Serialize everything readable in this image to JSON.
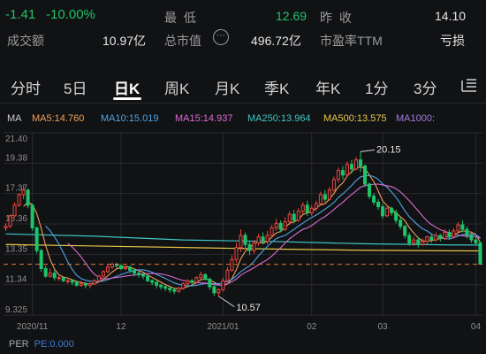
{
  "stats": {
    "change": "-1.41",
    "change_pct": "-10.00%",
    "low_label": "最 低",
    "low_value": "12.69",
    "prev_close_label": "昨 收",
    "prev_close_value": "14.10",
    "turnover_label": "成交额",
    "turnover_value": "10.97亿",
    "mktcap_label": "总市值",
    "mktcap_value": "496.72亿",
    "pe_label": "市盈率TTM",
    "pe_value": "亏损"
  },
  "tabs": [
    "分时",
    "5日",
    "日K",
    "周K",
    "月K",
    "季K",
    "年K",
    "1分",
    "3分"
  ],
  "active_tab": "日K",
  "ma": {
    "title": "MA",
    "items": [
      {
        "text": "MA5:14.760",
        "color": "#f0a05a"
      },
      {
        "text": "MA10:15.019",
        "color": "#4fa3e6"
      },
      {
        "text": "MA15:14.937",
        "color": "#d86cd3"
      },
      {
        "text": "MA250:13.964",
        "color": "#3fc5c5"
      },
      {
        "text": "MA500:13.575",
        "color": "#e6c64a"
      },
      {
        "text": "MA1000:",
        "color": "#a27be0"
      }
    ]
  },
  "chart_data": {
    "type": "candlestick",
    "y_ticks": [
      "21.40",
      "19.38",
      "17.37",
      "15.36",
      "13.35",
      "11.34",
      "9.325"
    ],
    "ylim": [
      9.325,
      21.4
    ],
    "x_labels": [
      {
        "label": "2020/11",
        "index": 6
      },
      {
        "label": "12",
        "index": 26
      },
      {
        "label": "2021/01",
        "index": 49
      },
      {
        "label": "02",
        "index": 69
      },
      {
        "label": "03",
        "index": 85
      },
      {
        "label": "04",
        "index": 106
      }
    ],
    "annotations": [
      {
        "label": "20.15",
        "index": 80,
        "value": 20.15
      },
      {
        "label": "10.57",
        "index": 48,
        "value": 10.57
      }
    ],
    "current_price": 12.69,
    "candles": [
      [
        15.1,
        15.2,
        14.9,
        15.4
      ],
      [
        15.2,
        15.9,
        15.1,
        16.0
      ],
      [
        15.9,
        16.6,
        15.8,
        16.8
      ],
      [
        16.6,
        17.3,
        16.5,
        17.4
      ],
      [
        17.3,
        17.6,
        17.0,
        17.9
      ],
      [
        17.6,
        16.6,
        16.4,
        17.7
      ],
      [
        16.6,
        15.1,
        14.9,
        16.7
      ],
      [
        15.1,
        13.6,
        13.4,
        15.2
      ],
      [
        13.6,
        12.4,
        12.2,
        13.7
      ],
      [
        12.4,
        11.9,
        11.8,
        12.6
      ],
      [
        11.9,
        12.1,
        11.8,
        12.4
      ],
      [
        12.1,
        11.8,
        11.6,
        12.3
      ],
      [
        11.8,
        11.8,
        11.6,
        12.0
      ],
      [
        11.8,
        11.6,
        11.5,
        11.9
      ],
      [
        11.6,
        11.6,
        11.4,
        11.8
      ],
      [
        11.6,
        11.5,
        11.3,
        11.7
      ],
      [
        11.5,
        11.3,
        11.2,
        11.6
      ],
      [
        11.3,
        11.4,
        11.2,
        11.6
      ],
      [
        11.4,
        11.3,
        11.1,
        11.5
      ],
      [
        11.3,
        11.4,
        11.1,
        11.5
      ],
      [
        11.4,
        11.6,
        11.3,
        11.7
      ],
      [
        11.6,
        11.9,
        11.5,
        12.0
      ],
      [
        11.9,
        12.2,
        11.8,
        12.3
      ],
      [
        12.2,
        12.5,
        12.1,
        12.7
      ],
      [
        12.5,
        12.7,
        12.4,
        12.8
      ],
      [
        12.7,
        12.6,
        12.4,
        12.8
      ],
      [
        12.6,
        12.4,
        12.3,
        12.7
      ],
      [
        12.4,
        12.5,
        12.3,
        12.6
      ],
      [
        12.5,
        12.3,
        12.1,
        12.6
      ],
      [
        12.3,
        12.1,
        11.9,
        12.4
      ],
      [
        12.1,
        12.0,
        11.8,
        12.2
      ],
      [
        12.0,
        11.9,
        11.7,
        12.1
      ],
      [
        11.9,
        11.6,
        11.5,
        12.0
      ],
      [
        11.6,
        11.5,
        11.3,
        11.7
      ],
      [
        11.5,
        11.3,
        11.1,
        11.6
      ],
      [
        11.3,
        11.2,
        11.0,
        11.4
      ],
      [
        11.2,
        11.1,
        10.9,
        11.3
      ],
      [
        11.1,
        11.0,
        10.8,
        11.2
      ],
      [
        11.0,
        10.9,
        10.7,
        11.1
      ],
      [
        10.9,
        11.1,
        10.8,
        11.2
      ],
      [
        11.1,
        11.4,
        11.0,
        11.5
      ],
      [
        11.4,
        11.6,
        11.3,
        11.7
      ],
      [
        11.6,
        11.5,
        11.3,
        11.7
      ],
      [
        11.5,
        11.8,
        11.4,
        11.9
      ],
      [
        11.8,
        12.0,
        11.7,
        12.2
      ],
      [
        12.0,
        11.7,
        11.6,
        12.1
      ],
      [
        11.7,
        11.2,
        11.0,
        11.8
      ],
      [
        11.2,
        10.8,
        10.6,
        11.3
      ],
      [
        10.8,
        11.0,
        10.57,
        11.1
      ],
      [
        11.0,
        11.6,
        10.9,
        11.8
      ],
      [
        11.6,
        12.3,
        11.5,
        12.5
      ],
      [
        12.3,
        13.0,
        12.2,
        13.3
      ],
      [
        13.0,
        13.8,
        12.8,
        14.1
      ],
      [
        13.8,
        14.6,
        13.5,
        15.0
      ],
      [
        14.6,
        14.0,
        13.8,
        14.8
      ],
      [
        14.0,
        13.6,
        13.3,
        14.2
      ],
      [
        13.6,
        14.1,
        13.4,
        14.3
      ],
      [
        14.1,
        14.5,
        13.9,
        14.7
      ],
      [
        14.5,
        14.2,
        14.0,
        14.8
      ],
      [
        14.2,
        14.6,
        14.0,
        14.9
      ],
      [
        14.6,
        15.1,
        14.4,
        15.3
      ],
      [
        15.1,
        15.4,
        14.9,
        15.7
      ],
      [
        15.4,
        15.0,
        14.8,
        15.6
      ],
      [
        15.0,
        15.5,
        14.9,
        15.8
      ],
      [
        15.5,
        16.0,
        15.3,
        16.2
      ],
      [
        16.0,
        15.6,
        15.4,
        16.3
      ],
      [
        15.6,
        16.2,
        15.5,
        16.4
      ],
      [
        16.2,
        16.6,
        16.0,
        16.8
      ],
      [
        16.6,
        16.1,
        15.9,
        16.9
      ],
      [
        16.1,
        16.4,
        15.9,
        16.6
      ],
      [
        16.4,
        16.7,
        16.2,
        16.9
      ],
      [
        16.7,
        17.3,
        16.6,
        17.5
      ],
      [
        17.3,
        17.0,
        16.8,
        17.6
      ],
      [
        17.0,
        17.6,
        16.9,
        17.8
      ],
      [
        17.6,
        18.3,
        17.5,
        18.5
      ],
      [
        18.3,
        18.9,
        18.1,
        19.1
      ],
      [
        18.9,
        18.6,
        18.3,
        19.2
      ],
      [
        18.6,
        19.3,
        18.5,
        19.5
      ],
      [
        19.3,
        19.0,
        18.7,
        19.6
      ],
      [
        19.0,
        19.6,
        18.9,
        19.8
      ],
      [
        19.6,
        19.2,
        18.8,
        20.15
      ],
      [
        19.2,
        18.0,
        17.8,
        19.3
      ],
      [
        18.0,
        17.2,
        17.0,
        18.1
      ],
      [
        17.2,
        16.8,
        16.6,
        17.4
      ],
      [
        16.8,
        16.5,
        16.3,
        17.0
      ],
      [
        16.5,
        15.9,
        15.7,
        16.7
      ],
      [
        15.9,
        16.4,
        15.8,
        16.6
      ],
      [
        16.4,
        16.1,
        15.9,
        16.5
      ],
      [
        16.1,
        15.6,
        15.4,
        16.3
      ],
      [
        15.6,
        15.2,
        15.0,
        15.8
      ],
      [
        15.2,
        14.6,
        14.4,
        15.3
      ],
      [
        14.6,
        14.1,
        13.9,
        14.8
      ],
      [
        14.1,
        14.3,
        13.9,
        14.5
      ],
      [
        14.3,
        14.0,
        13.8,
        14.5
      ],
      [
        14.0,
        14.2,
        13.9,
        14.4
      ],
      [
        14.2,
        14.5,
        14.0,
        14.6
      ],
      [
        14.5,
        14.3,
        14.1,
        14.7
      ],
      [
        14.3,
        14.6,
        14.2,
        14.8
      ],
      [
        14.6,
        14.4,
        14.2,
        14.7
      ],
      [
        14.4,
        14.8,
        14.3,
        15.0
      ],
      [
        14.8,
        14.5,
        14.3,
        15.0
      ],
      [
        14.5,
        14.9,
        14.4,
        15.1
      ],
      [
        14.9,
        15.3,
        14.8,
        15.5
      ],
      [
        15.3,
        15.0,
        14.8,
        15.6
      ],
      [
        15.0,
        14.6,
        14.4,
        15.2
      ],
      [
        14.6,
        14.3,
        14.1,
        14.8
      ],
      [
        14.3,
        14.1,
        14.0,
        14.5
      ],
      [
        14.1,
        12.69,
        12.69,
        14.2
      ]
    ],
    "ma": [
      {
        "name": "MA250",
        "color": "#3fc5c5",
        "points": [
          [
            0,
            14.7
          ],
          [
            20,
            14.55
          ],
          [
            40,
            14.3
          ],
          [
            60,
            14.2
          ],
          [
            80,
            14.05
          ],
          [
            100,
            13.97
          ],
          [
            107,
            13.964
          ]
        ]
      },
      {
        "name": "MA500",
        "color": "#e6c64a",
        "points": [
          [
            0,
            14.0
          ],
          [
            20,
            13.9
          ],
          [
            40,
            13.8
          ],
          [
            60,
            13.7
          ],
          [
            80,
            13.62
          ],
          [
            100,
            13.58
          ],
          [
            107,
            13.575
          ]
        ]
      }
    ],
    "per": "PE:0.000"
  }
}
